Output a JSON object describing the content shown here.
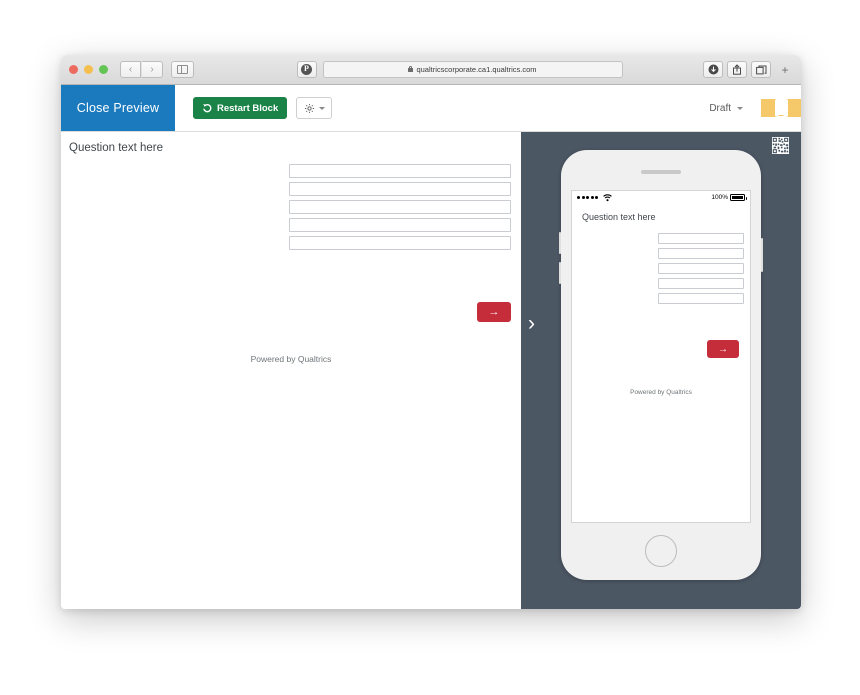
{
  "browser": {
    "traffic_lights": [
      "close",
      "minimize",
      "zoom"
    ],
    "back_label": "‹",
    "forward_label": "›",
    "sidebar_icon": "sidebar-icon",
    "pinterest_icon": "pinterest-icon",
    "url": "qualtricscorporate.ca1.qualtrics.com",
    "lock_icon": "lock-icon",
    "download_icon": "download-icon",
    "share_icon": "share-icon",
    "tabs_icon": "tab-overview-icon",
    "new_tab_label": "+"
  },
  "toolbar": {
    "close_preview_label": "Close Preview",
    "restart_block_label": "Restart Block",
    "restart_icon": "undo-arrow-icon",
    "gear_icon": "gear-icon",
    "gear_caret": "chevron-down-icon",
    "draft_label": "Draft",
    "draft_caret": "chevron-down-icon",
    "device_icon": "mobile-phone-icon",
    "colors": {
      "close_preview_bg": "#1a7abd",
      "restart_bg": "#1b8348",
      "device_bg": "#f5c96a",
      "mobile_pane_bg": "#4c5764",
      "next_button_bg": "#c62d3b"
    }
  },
  "desktop_preview": {
    "question_title": "Question text here",
    "choices": [
      {
        "value": "",
        "placeholder": ""
      },
      {
        "value": "",
        "placeholder": ""
      },
      {
        "value": "",
        "placeholder": ""
      },
      {
        "value": "",
        "placeholder": ""
      },
      {
        "value": "",
        "placeholder": ""
      }
    ],
    "next_label": "→",
    "footer": "Powered by Qualtrics"
  },
  "mobile_pane": {
    "qr_icon": "qr-code-icon",
    "expand_chevron": "›",
    "phone": {
      "status_bar": {
        "signal_dots": 5,
        "wifi_icon": "wifi-icon",
        "battery_percent": "100%",
        "battery_icon": "battery-full-icon"
      },
      "question_title": "Question text here",
      "choices": [
        {
          "value": "",
          "placeholder": ""
        },
        {
          "value": "",
          "placeholder": ""
        },
        {
          "value": "",
          "placeholder": ""
        },
        {
          "value": "",
          "placeholder": ""
        },
        {
          "value": "",
          "placeholder": ""
        }
      ],
      "next_label": "→",
      "footer": "Powered by Qualtrics",
      "home_button": "home-button"
    }
  }
}
